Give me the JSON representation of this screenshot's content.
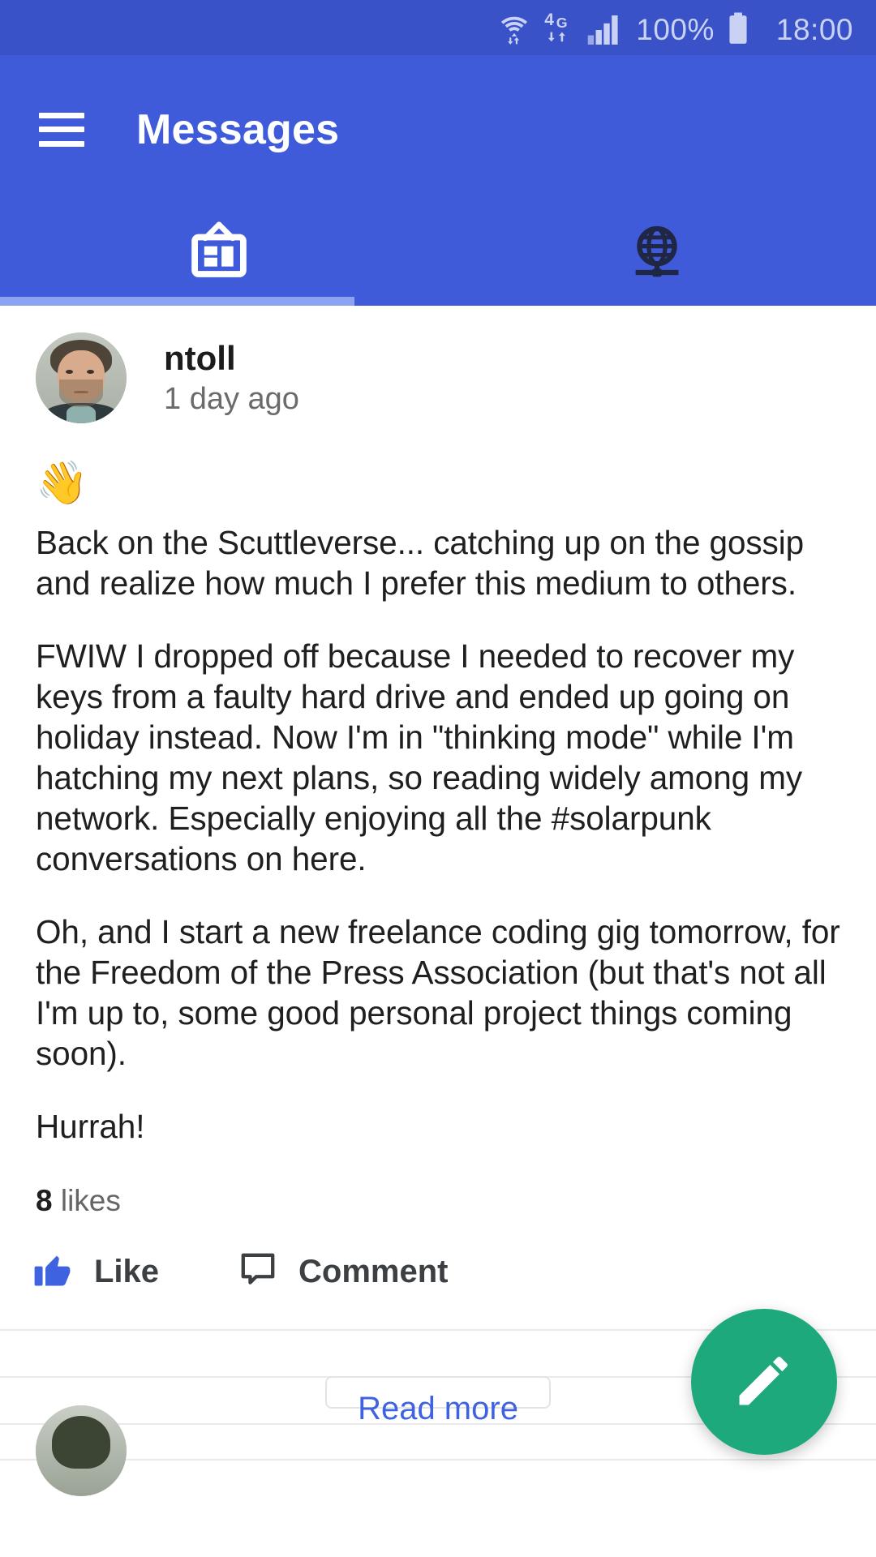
{
  "status_bar": {
    "wifi_icon": "wifi-icon",
    "network_label": "4G",
    "signal_icon": "signal-bars-icon",
    "battery_percent": "100%",
    "battery_icon": "battery-full-icon",
    "clock": "18:00",
    "background_color": "#3A52C8",
    "text_color": "#C9D2F3"
  },
  "app_bar": {
    "menu_icon": "hamburger-menu-icon",
    "title": "Messages",
    "background_color": "#3F5BD9"
  },
  "tabs": {
    "items": [
      {
        "name": "public-feed-tab",
        "icon": "noticeboard-icon",
        "selected": true
      },
      {
        "name": "network-tab",
        "icon": "globe-network-icon",
        "selected": false
      }
    ],
    "indicator_color": "#8EA2F2"
  },
  "post": {
    "author": "ntoll",
    "timestamp": "1 day ago",
    "avatar_icon": "user-avatar",
    "emoji": "👋",
    "paragraphs": [
      "Back on the Scuttleverse... catching up on the gossip and realize how much I prefer this medium to others.",
      "FWIW I dropped off because I needed to recover my keys from a faulty hard drive and ended up going on holiday instead. Now I'm in \"thinking mode\" while I'm hatching my next plans, so reading widely among my network. Especially enjoying all the #solarpunk conversations on here.",
      "Oh, and I start a new freelance coding gig tomorrow, for the Freedom of the Press Association (but that's not all I'm up to, some good personal project things coming soon).",
      "Hurrah!"
    ],
    "likes_count": "8",
    "likes_label": "likes",
    "actions": [
      {
        "name": "like-button",
        "icon": "thumbs-up-icon",
        "label": "Like",
        "color": "#3F62E0"
      },
      {
        "name": "comment-button",
        "icon": "comment-bubble-icon",
        "label": "Comment",
        "color": "#3C4043"
      }
    ],
    "read_more_label": "Read more",
    "read_more_color": "#3F62E0"
  },
  "fab": {
    "name": "compose-button",
    "icon": "pencil-icon",
    "color": "#1EA97C"
  }
}
